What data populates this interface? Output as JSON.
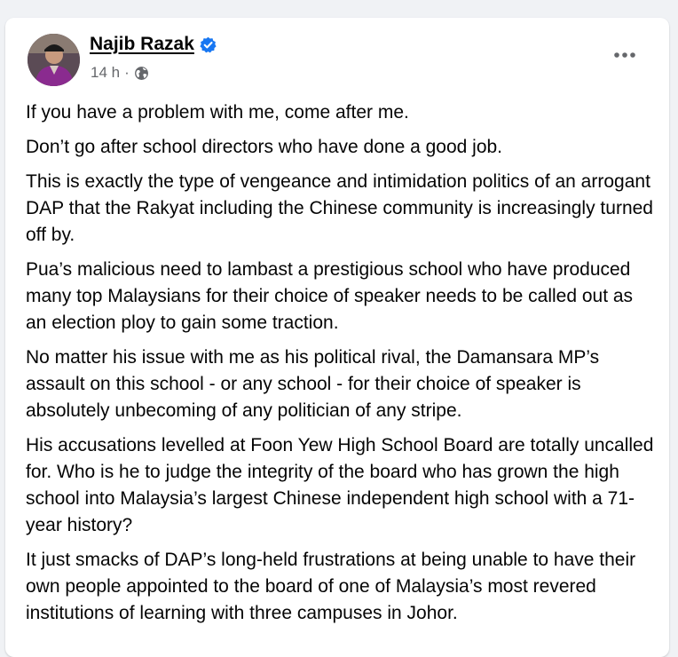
{
  "post": {
    "author": "Najib Razak",
    "timestamp": "14 h",
    "separator": "·",
    "audience_icon": "globe-icon",
    "verified_icon": "verified-badge-icon",
    "menu_icon": "more-options-icon",
    "colors": {
      "verified": "#1877f2",
      "text": "#050505",
      "meta": "#65676b",
      "background": "#f0f2f5",
      "card": "#ffffff"
    },
    "paragraphs": [
      "If you have a problem with me, come after me.",
      "Don’t go after school directors who have done a good job.",
      "This is exactly the type of vengeance and intimidation politics of an arrogant DAP that the Rakyat including the Chinese community is increasingly turned off by.",
      "Pua’s malicious need to lambast a prestigious school who have produced many top Malaysians for their choice of speaker needs to be called out as an election ploy to gain some traction.",
      "No matter his issue with me as his political rival, the Damansara MP’s assault on this school - or any school - for their choice of speaker is absolutely unbecoming of any politician of any stripe.",
      "His accusations levelled at Foon Yew High School Board are totally uncalled for. Who is he to judge the integrity of the board who has grown the high school into Malaysia’s largest Chinese independent high school with a 71-year history?",
      "It just smacks of DAP’s long-held frustrations at being unable to have their own people appointed to the board of one of Malaysia’s most revered institutions of learning with three campuses in Johor."
    ]
  }
}
